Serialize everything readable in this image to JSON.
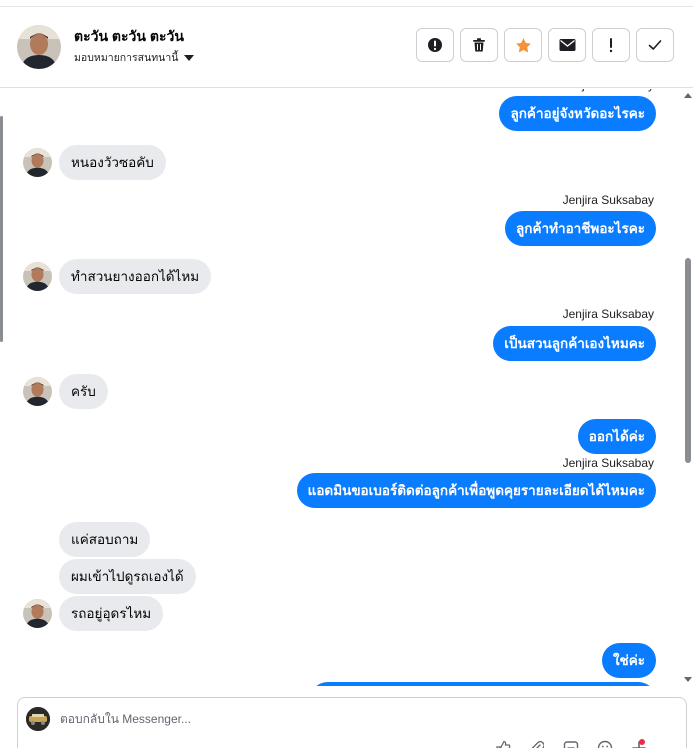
{
  "header": {
    "contact_name": "ตะวัน ตะวัน ตะวัน",
    "assign_label": "มอบหมายการสนทนานี้",
    "actions": [
      {
        "name": "spam-button",
        "icon": "alert-circle-icon",
        "color": "#1c1e21"
      },
      {
        "name": "delete-button",
        "icon": "trash-icon",
        "color": "#1c1e21"
      },
      {
        "name": "star-button",
        "icon": "star-icon",
        "color": "#f7923b"
      },
      {
        "name": "mark-unread-button",
        "icon": "envelope-icon",
        "color": "#1c1e21"
      },
      {
        "name": "follow-up-button",
        "icon": "exclamation-icon",
        "color": "#1c1e21"
      },
      {
        "name": "mark-done-button",
        "icon": "checkmark-icon",
        "color": "#1c1e21"
      }
    ]
  },
  "thread": {
    "incoming_color": "#e9eaed",
    "outgoing_color": "#0a7cff",
    "messages": [
      {
        "dir": "out",
        "sender": "Jenjira Suksabay",
        "text": "ลูกค้าอยู่จังหวัดอะไรคะ"
      },
      {
        "dir": "in",
        "text": "หนองวัวซอคับ"
      },
      {
        "dir": "out",
        "sender": "Jenjira Suksabay",
        "text": "ลูกค้าทำอาชีพอะไรคะ"
      },
      {
        "dir": "in",
        "text": "ทำสวนยางออกได้ไหม"
      },
      {
        "dir": "out",
        "sender": "Jenjira Suksabay",
        "text": "เป็นสวนลูกค้าเองไหมคะ"
      },
      {
        "dir": "in",
        "text": "ครับ"
      },
      {
        "dir": "out",
        "text": "ออกได้ค่ะ"
      },
      {
        "dir": "out",
        "sender": "Jenjira Suksabay",
        "text": "แอดมินขอเบอร์ติดต่อลูกค้าเพื่อพูดคุยรายละเอียดได้ไหมคะ"
      },
      {
        "dir": "in",
        "text": "แค่สอบถาม"
      },
      {
        "dir": "in",
        "text": "ผมเข้าไปดูรถเองได้"
      },
      {
        "dir": "in",
        "text": "รถอยู่อุดรไหม"
      },
      {
        "dir": "out",
        "text": "ใช่ค่ะ"
      }
    ]
  },
  "composer": {
    "placeholder": "ตอบกลับใน Messenger...",
    "tools": [
      "thumbs-up-icon",
      "attachment-icon",
      "saved-reply-icon",
      "emoji-icon",
      "more-tools-icon"
    ]
  }
}
